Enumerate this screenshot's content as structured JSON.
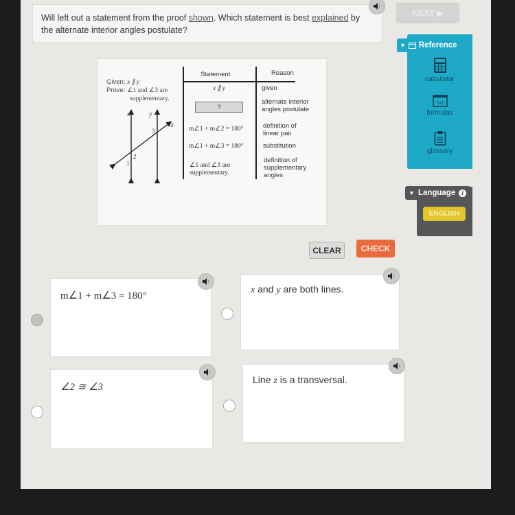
{
  "question": {
    "part1": "Will left out a statement from the proof ",
    "link1": "shown",
    "part2": ". Which statement is best ",
    "link2": "explained",
    "part3": " by the alternate interior angles postulate?"
  },
  "nav": {
    "next_label": "NEXT ▶"
  },
  "reference": {
    "header": "Reference",
    "items": [
      {
        "label": "calculator",
        "icon": "calculator-icon"
      },
      {
        "label": "formulas",
        "icon": "formulas-icon"
      },
      {
        "label": "glossary",
        "icon": "clipboard-icon"
      }
    ]
  },
  "language": {
    "header": "Language",
    "selected": "ENGLISH"
  },
  "figure": {
    "given_label": "Given:",
    "given_value": "x ∥ y",
    "prove_label": "Prove:",
    "prove_line1": "∠1 and ∠3 are",
    "prove_line2": "supplementary.",
    "diagram_labels": {
      "x": "x",
      "y": "y",
      "z": "z",
      "a1": "1",
      "a2": "2",
      "a3": "3"
    },
    "table": {
      "headers": [
        "Statement",
        "Reason"
      ],
      "rows": [
        {
          "statement": "x ∥ y",
          "reason": "given"
        },
        {
          "statement": "?",
          "reason": "alternate interior angles postulate"
        },
        {
          "statement": "m∠1 + m∠2 = 180°",
          "reason": "definition of linear pair"
        },
        {
          "statement": "m∠1 + m∠3 = 180°",
          "reason": "substitution"
        },
        {
          "statement": "∠1 and ∠3 are supplementary.",
          "reason": "definition of supplementary angles"
        }
      ]
    }
  },
  "actions": {
    "clear_label": "CLEAR",
    "check_label": "CHECK"
  },
  "choices": [
    {
      "text": "m∠1 + m∠3 = 180°",
      "selected": true
    },
    {
      "pre": "",
      "var1": "x",
      "mid": " and ",
      "var2": "y",
      "post": " are both lines.",
      "selected": false
    },
    {
      "text": "∠2 ≅ ∠3",
      "selected": false
    },
    {
      "pre": "Line ",
      "var1": "z",
      "post": " is a transversal.",
      "selected": false
    }
  ]
}
